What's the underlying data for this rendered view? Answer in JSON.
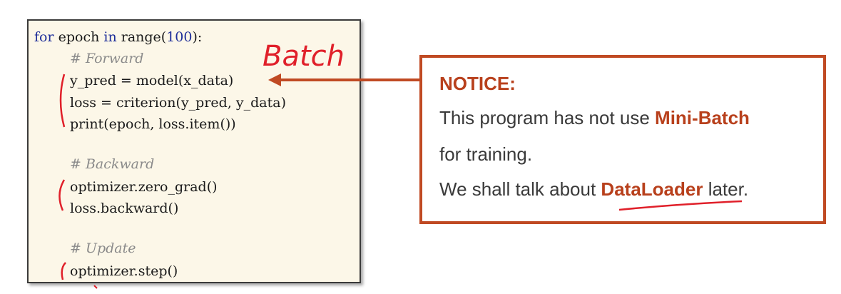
{
  "code": {
    "line1": {
      "kw1": "for",
      "t1": " epoch ",
      "kw2": "in",
      "t2": " range(",
      "num": "100",
      "t3": "):"
    },
    "comment_forward": "# Forward",
    "line_pred": "y_pred = model(x_data)",
    "line_loss": "loss = criterion(y_pred, y_data)",
    "line_print": "print(epoch, loss.item())",
    "comment_backward": "# Backward",
    "line_zero": "optimizer.zero_grad()",
    "line_backward": "loss.backward()",
    "comment_update": "# Update",
    "line_step": "optimizer.step()"
  },
  "annotation": {
    "handwritten": "Batch"
  },
  "notice": {
    "title": "NOTICE:",
    "l1_pre": "This program has not use ",
    "l1_hl": "Mini-Batch",
    "l2": "for training.",
    "l3_pre": "We shall talk about ",
    "l3_hl": "DataLoader",
    "l3_post": " later."
  },
  "colors": {
    "accent": "#c04a23",
    "keyword": "#1f2f9a",
    "comment": "#8a8a8a",
    "ink": "#e0202a",
    "panel_bg": "#fcf7e8"
  }
}
